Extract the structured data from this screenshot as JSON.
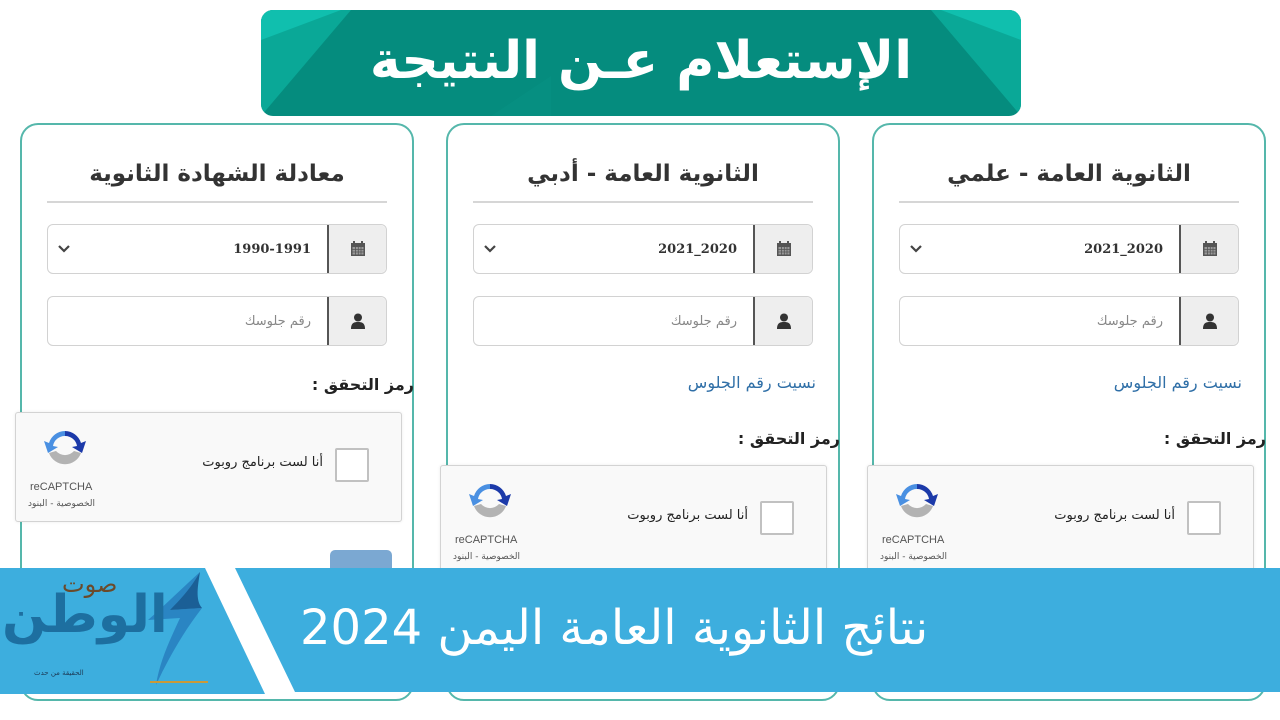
{
  "header": {
    "title": "الإستعلام عـن النتيجة"
  },
  "cards": [
    {
      "title": "الثانوية العامة - علمي",
      "year_value": "2021_2020",
      "seat_placeholder": "رقم جلوسك",
      "forgot_link": "نسيت رقم الجلوس",
      "verify_label": "رمز التحقق :",
      "captcha": {
        "label": "أنا لست برنامج روبوت",
        "brand": "reCAPTCHA",
        "terms": "الخصوصية - البنود"
      }
    },
    {
      "title": "الثانوية العامة - أدبي",
      "year_value": "2021_2020",
      "seat_placeholder": "رقم جلوسك",
      "forgot_link": "نسيت رقم الجلوس",
      "verify_label": "رمز التحقق :",
      "captcha": {
        "label": "أنا لست برنامج روبوت",
        "brand": "reCAPTCHA",
        "terms": "الخصوصية - البنود"
      }
    },
    {
      "title": "معادلة الشهادة الثانوية",
      "year_value": "1990-1991",
      "seat_placeholder": "رقم جلوسك",
      "verify_label": "رمز التحقق :",
      "captcha": {
        "label": "أنا لست برنامج روبوت",
        "brand": "reCAPTCHA",
        "terms": "الخصوصية - البنود"
      }
    }
  ],
  "banner": {
    "title": "نتائج الثانوية العامة اليمن 2024",
    "logo_main": "الوطن",
    "logo_top": "صوت",
    "logo_tagline": "الحقيقة من حدث"
  },
  "colors": {
    "header_bg": "#058c7e",
    "card_border": "#55b7ab",
    "link": "#2f6fa7",
    "banner_bg": "#3daede",
    "button": "#7ba8d2"
  }
}
